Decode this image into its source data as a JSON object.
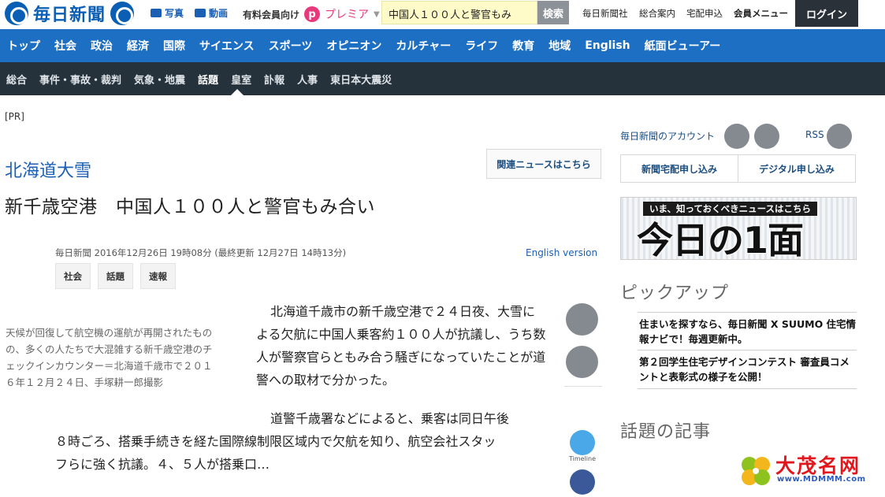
{
  "header": {
    "logo_text": "毎日新聞",
    "photo_label": "写真",
    "video_label": "動画",
    "premier_prefix": "有料会員向け",
    "premier_label": "プレミア",
    "search_value": "中国人１００人と警官もみ",
    "search_button": "検索",
    "util_links": [
      "毎日新聞社",
      "総合案内",
      "宅配申込"
    ],
    "member_menu": "会員メニュー",
    "login": "ログイン"
  },
  "nav_primary": [
    "トップ",
    "社会",
    "政治",
    "経済",
    "国際",
    "サイエンス",
    "スポーツ",
    "オピニオン",
    "カルチャー",
    "ライフ",
    "教育",
    "地域",
    "English",
    "紙面ビューアー"
  ],
  "nav_secondary": [
    "総合",
    "事件・事故・裁判",
    "気象・地震",
    "話題",
    "皇室",
    "訃報",
    "人事",
    "東日本大震災"
  ],
  "article": {
    "pr": "[PR]",
    "topic": "北海道大雪",
    "related_news": "関連ニュースはこちら",
    "headline": "新千歳空港　中国人１００人と警官もみ合い",
    "meta": "毎日新聞  2016年12月26日 19時08分 (最終更新 12月27日 14時13分)",
    "english_version": "English version",
    "tags": [
      "社会",
      "話題",
      "速報"
    ],
    "caption": "天候が回復して航空機の運航が再開されたものの、多くの人たちで大混雑する新千歳空港のチェックインカウンター＝北海道千歳市で２０１６年１２月２４日、手塚耕一郎撮影",
    "paragraph1": "北海道千歳市の新千歳空港で２４日夜、大雪による欠航に中国人乗客約１００人が抗議し、うち数人が警察官らともみ合う騒ぎになっていたことが道警への取材で分かった。",
    "paragraph2_line1": "道警千歳署などによると、乗客は同日午後",
    "paragraph2_line2": "８時ごろ、搭乗手続きを経た国際線制限区域内で欠航を知り、航空会社スタッ",
    "paragraph2_line3": "フらに強く抗議。４、５人が搭乗口…",
    "timeline_label": "Timeline"
  },
  "sidebar": {
    "account_label": "毎日新聞のアカウント",
    "rss_label": "RSS",
    "delivery_button": "新聞宅配申し込み",
    "digital_button": "デジタル申し込み",
    "front_banner": "いま、知っておくべきニュースはこちら",
    "front_title": "今日の1面",
    "pickup_heading": "ピックアップ",
    "pickup_items": [
      "住まいを探すなら、毎日新聞 X SUUMO 住宅情報ナビで！毎週更新中。",
      "第２回学生住宅デザインコンテスト 審査員コメントと表彰式の様子を公開！"
    ],
    "wadai_heading": "話題の記事"
  },
  "watermark": {
    "title": "大茂名网",
    "url": "www.MDMMM.com"
  },
  "colors": {
    "nav_primary_bg": "#1c6fc2",
    "nav_secondary_bg": "#25323c",
    "brand_blue": "#0a5fb4",
    "premier_pink": "#e8397c"
  }
}
